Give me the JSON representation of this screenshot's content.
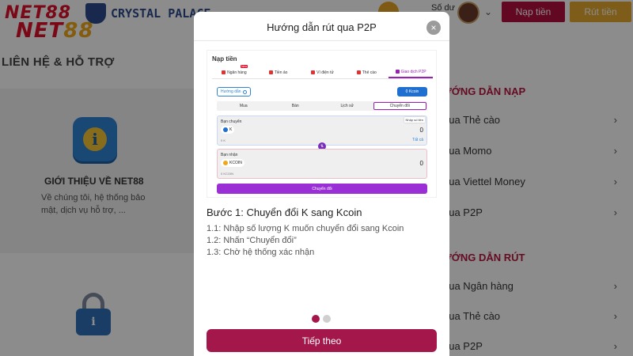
{
  "header": {
    "logo_line1": "NET88",
    "logo_line2_a": "NET",
    "logo_line2_b": "88",
    "club_name": "CRYSTAL PALACE",
    "balance_label": "Số dư",
    "deposit_label": "Nạp tiền",
    "withdraw_label": "Rút tiền"
  },
  "background": {
    "section_title": "LIÊN HỆ & HỖ TRỢ",
    "card_title": "GIỚI THIỆU VỀ NET88",
    "card_text": "Về chúng tôi, hệ thống bảo mật, dịch vụ hỗ trợ, ...",
    "deposit_guide_heading": "ƯỚNG DẪN NẠP",
    "deposit_items": [
      "qua Thẻ cào",
      "qua Momo",
      "qua Viettel Money",
      "qua P2P"
    ],
    "withdraw_guide_heading": "ƯỚNG DẪN RÚT",
    "withdraw_items": [
      "qua Ngân hàng",
      "qua Thẻ cào",
      "qua P2P"
    ]
  },
  "modal": {
    "title": "Hướng dẫn rút qua P2P",
    "close": "×",
    "screenshot": {
      "title": "Nạp tiền",
      "tabs": [
        "Ngân hàng",
        "Tiền ảo",
        "Ví điện tử",
        "Thẻ cào",
        "Giao dịch P2P"
      ],
      "new_badge": "New",
      "guide_button": "Hướng dẫn",
      "wallet_button": "0 Kcoin",
      "sub_tabs": [
        "Mua",
        "Bán",
        "Lịch sử",
        "Chuyển đổi"
      ],
      "from_label": "Bạn chuyển",
      "from_asset": "K",
      "from_amount": "0",
      "from_balance": "0 K",
      "from_all": "Tất cả",
      "amount_hint": "Nhập số tiền",
      "to_label": "Bạn nhận",
      "to_asset": "KCOIN",
      "to_amount": "0",
      "to_balance": "0 KCOIN",
      "convert_button": "Chuyển đổi"
    },
    "step_title": "Bước 1: Chuyển đổi K sang Kcoin",
    "step_lines": [
      "1.1: Nhập số lượng K muốn chuyển đổi sang Kcoin",
      "1.2: Nhấn “Chuyển đổi”",
      "1.3: Chờ hệ thống xác nhận"
    ],
    "pagination": {
      "current": 1,
      "total": 2
    },
    "next_button": "Tiếp theo"
  },
  "colors": {
    "brand": "#a3174a",
    "deposit": "#b20f3e",
    "withdraw": "#e3a92f",
    "accent_purple": "#9a2fd6"
  }
}
